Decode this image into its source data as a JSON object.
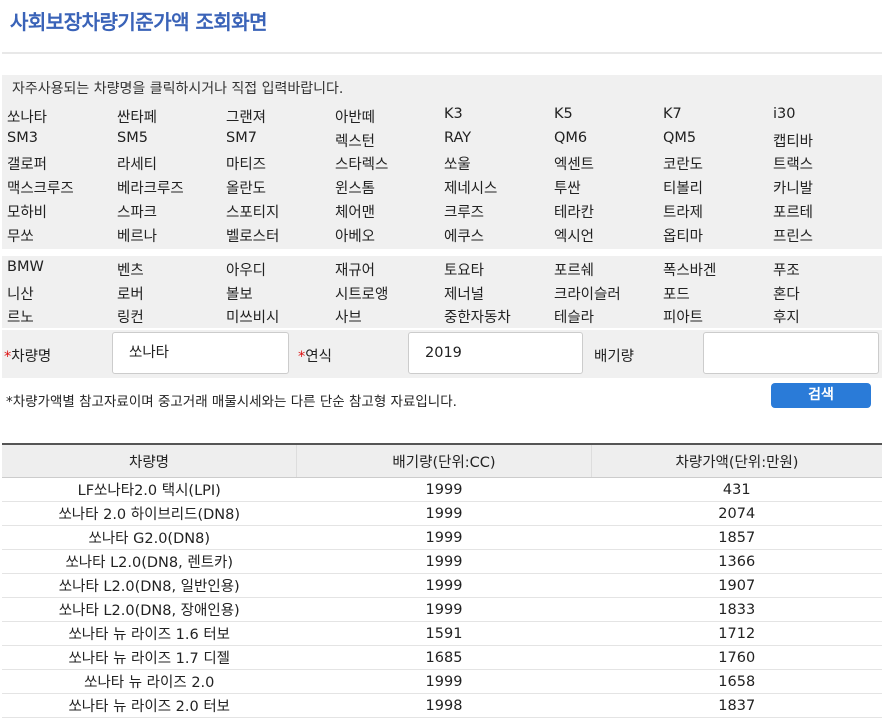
{
  "page_title": "사회보장차량기준가액 조회화면",
  "guide_text": "자주사용되는 차량명을 클릭하시거나 직접 입력바랍니다.",
  "domestic_cars": [
    [
      "쏘나타",
      "싼타페",
      "그랜져",
      "아반떼",
      "K3",
      "K5",
      "K7",
      "i30"
    ],
    [
      "SM3",
      "SM5",
      "SM7",
      "렉스턴",
      "RAY",
      "QM6",
      "QM5",
      "캡티바"
    ],
    [
      "갤로퍼",
      "라세티",
      "마티즈",
      "스타렉스",
      "쏘울",
      "엑센트",
      "코란도",
      "트랙스"
    ],
    [
      "맥스크루즈",
      "베라크루즈",
      "올란도",
      "윈스톰",
      "제네시스",
      "투싼",
      "티볼리",
      "카니발"
    ],
    [
      "모하비",
      "스파크",
      "스포티지",
      "체어맨",
      "크루즈",
      "테라칸",
      "트라제",
      "포르테"
    ],
    [
      "무쏘",
      "베르나",
      "벨로스터",
      "아베오",
      "에쿠스",
      "엑시언",
      "옵티마",
      "프린스"
    ]
  ],
  "foreign_cars": [
    [
      "BMW",
      "벤츠",
      "아우디",
      "재규어",
      "토요타",
      "포르쉐",
      "폭스바겐",
      "푸조"
    ],
    [
      "니산",
      "로버",
      "볼보",
      "시트로앵",
      "제너널",
      "크라이슬러",
      "포드",
      "혼다"
    ],
    [
      "르노",
      "링컨",
      "미쓰비시",
      "사브",
      "중한자동차",
      "테슬라",
      "피아트",
      "후지"
    ]
  ],
  "form": {
    "required_mark": "*",
    "car_name_label": "차량명",
    "car_name_value": "쏘나타",
    "year_label": "연식",
    "year_value": "2019",
    "displacement_label": "배기량",
    "displacement_value": ""
  },
  "note": "*차량가액별 참고자료이며 중고거래 매물시세와는 다른 단순 참고형 자료입니다.",
  "search_button": "검색",
  "table": {
    "headers": [
      "차량명",
      "배기량(단위:CC)",
      "차량가액(단위:만원)"
    ],
    "rows": [
      [
        "LF쏘나타2.0 택시(LPI)",
        "1999",
        "431"
      ],
      [
        "쏘나타 2.0 하이브리드(DN8)",
        "1999",
        "2074"
      ],
      [
        "쏘나타 G2.0(DN8)",
        "1999",
        "1857"
      ],
      [
        "쏘나타 L2.0(DN8, 렌트카)",
        "1999",
        "1366"
      ],
      [
        "쏘나타 L2.0(DN8, 일반인용)",
        "1999",
        "1907"
      ],
      [
        "쏘나타 L2.0(DN8, 장애인용)",
        "1999",
        "1833"
      ],
      [
        "쏘나타 뉴 라이즈 1.6 터보",
        "1591",
        "1712"
      ],
      [
        "쏘나타 뉴 라이즈 1.7 디젤",
        "1685",
        "1760"
      ],
      [
        "쏘나타 뉴 라이즈 2.0",
        "1999",
        "1658"
      ],
      [
        "쏘나타 뉴 라이즈 2.0 터보",
        "1998",
        "1837"
      ]
    ]
  }
}
